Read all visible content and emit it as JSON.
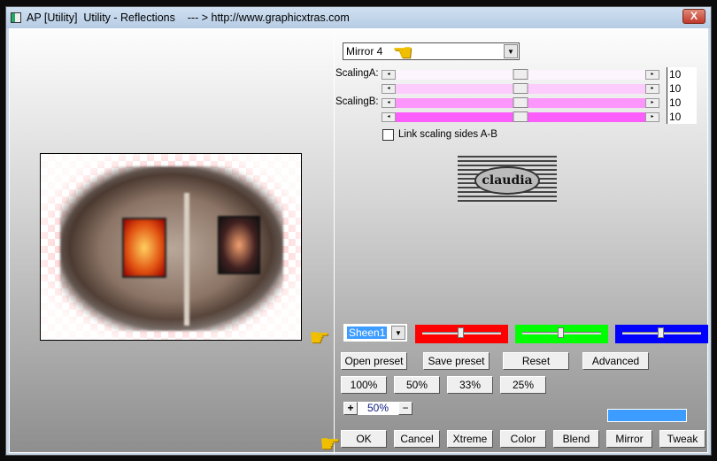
{
  "window": {
    "title": "AP [Utility]  Utility - Reflections    --- > http://www.graphicxtras.com",
    "close_label": "X"
  },
  "mode_select": {
    "value": "Mirror 4"
  },
  "sliders": [
    {
      "label": "ScalingA:",
      "value": "10",
      "position": 50,
      "color": "#fdf5fd"
    },
    {
      "label": "",
      "value": "10",
      "position": 50,
      "color": "#fcccfc"
    },
    {
      "label": "ScalingB:",
      "value": "10",
      "position": 50,
      "color": "#fc96fc"
    },
    {
      "label": "",
      "value": "10",
      "position": 50,
      "color": "#fc5efc"
    }
  ],
  "link_checkbox": {
    "label": "Link scaling sides A-B",
    "checked": false
  },
  "logo": {
    "text": "claudia"
  },
  "preset_select": {
    "value": "Sheen1"
  },
  "color_sliders": [
    {
      "name": "red",
      "color": "#ff0000",
      "position": 45
    },
    {
      "name": "green",
      "color": "#00ff00",
      "position": 45
    },
    {
      "name": "blue",
      "color": "#0000ff",
      "position": 45
    }
  ],
  "buttons_row1": [
    "Open preset",
    "Save preset",
    "Reset",
    "Advanced"
  ],
  "zoom_buttons": [
    "100%",
    "50%",
    "33%",
    "25%"
  ],
  "zoom": {
    "plus": "+",
    "value": "50%",
    "minus": "−"
  },
  "color_swatch": "#3d9cff",
  "bottom_buttons": [
    "OK",
    "Cancel",
    "Xtreme",
    "Color",
    "Blend",
    "Mirror",
    "Tweak"
  ]
}
